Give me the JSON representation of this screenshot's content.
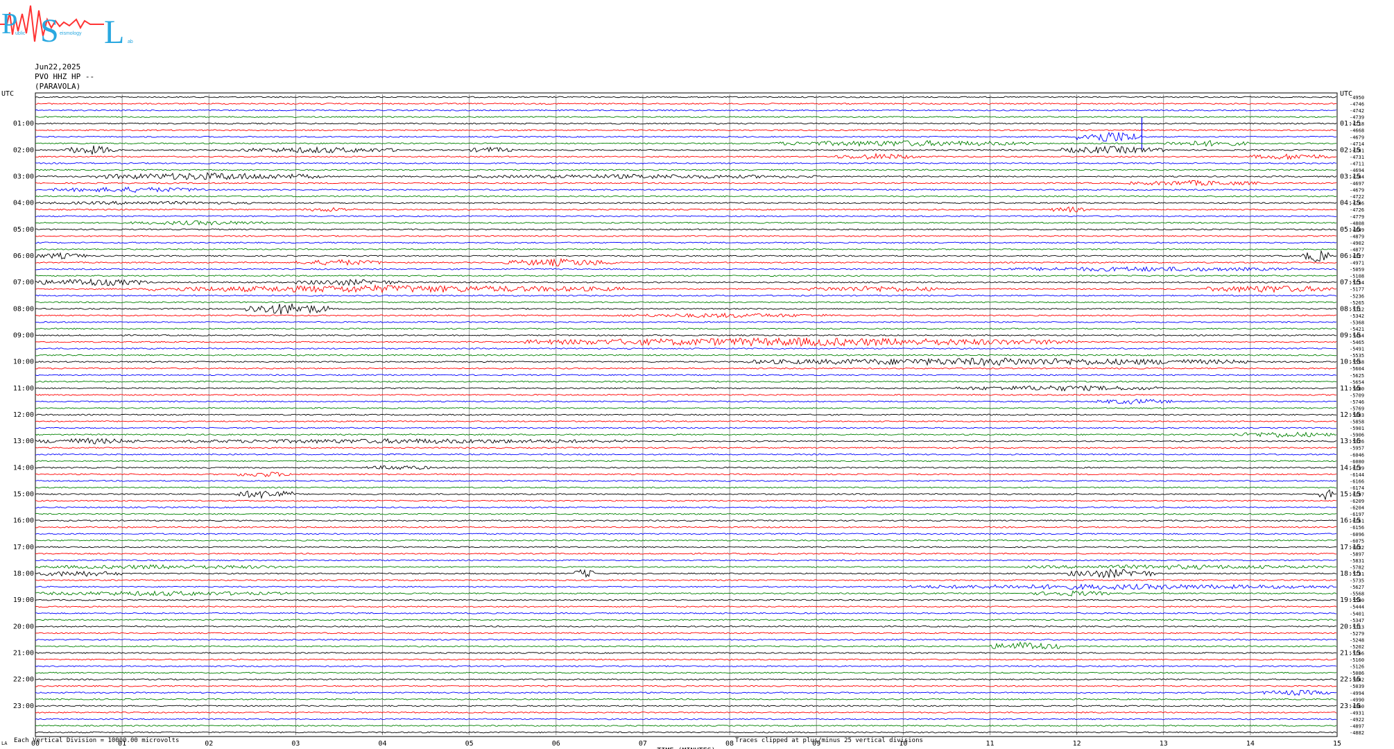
{
  "logo": {
    "big_letters": [
      "P",
      "S",
      "L"
    ],
    "small_text": [
      "ublic",
      "eismology",
      "ab"
    ],
    "colors": {
      "letters": "#29a8e0",
      "wave": "#ff3333"
    }
  },
  "header": {
    "date": "Jun22,2025",
    "station": "PVO HHZ HP --",
    "location": "(PARAVOLA)"
  },
  "axes": {
    "left_label": "UTC",
    "right_label": "UTC",
    "xlabel": "TIME (MINUTES)",
    "x_ticks": [
      "00",
      "01",
      "02",
      "03",
      "04",
      "05",
      "06",
      "07",
      "08",
      "09",
      "10",
      "11",
      "12",
      "13",
      "14",
      "15"
    ],
    "left_hours": [
      "01:00",
      "02:00",
      "03:00",
      "04:00",
      "05:00",
      "06:00",
      "07:00",
      "08:00",
      "09:00",
      "10:00",
      "11:00",
      "12:00",
      "13:00",
      "14:00",
      "15:00",
      "16:00",
      "17:00",
      "18:00",
      "19:00",
      "20:00",
      "21:00",
      "22:00",
      "23:00"
    ],
    "right_hours": [
      "01:15",
      "02:15",
      "03:15",
      "04:15",
      "05:15",
      "06:15",
      "07:15",
      "08:15",
      "09:15",
      "10:15",
      "11:15",
      "12:15",
      "13:15",
      "14:15",
      "15:15",
      "16:15",
      "17:15",
      "18:15",
      "19:15",
      "20:15",
      "21:15",
      "22:15",
      "23:15"
    ]
  },
  "footer": {
    "left_mark": "LA",
    "scale_note": "Each Vertical Division = 10000.00 microvolts",
    "clip_note": "Traces clipped at plus/minus 25 vertical divisions"
  },
  "chart_data": {
    "type": "line",
    "title": "",
    "xlabel": "TIME (MINUTES)",
    "ylabel": "UTC",
    "xlim": [
      0,
      15
    ],
    "trace_colors": [
      "#000000",
      "#ff0000",
      "#0000ff",
      "#008000"
    ],
    "trace_offsets": [
      -4950,
      -4746,
      -4742,
      -4739,
      -4718,
      -4668,
      -4679,
      -4714,
      -4741,
      -4731,
      -4711,
      -4694,
      -4744,
      -4697,
      -4679,
      -4722,
      -4746,
      -4726,
      -4779,
      -4808,
      -4849,
      -4879,
      -4902,
      -4877,
      -4927,
      -4971,
      -5059,
      -5108,
      -5154,
      -5177,
      -5236,
      -5265,
      -5312,
      -5342,
      -5368,
      -5421,
      -5454,
      -5465,
      -5491,
      -5535,
      -5558,
      -5604,
      -5625,
      -5654,
      -5680,
      -5709,
      -5746,
      -5769,
      -5803,
      -5858,
      -5901,
      -5906,
      -5926,
      -5957,
      -6046,
      -6080,
      -6139,
      -6144,
      -6166,
      -6174,
      -6197,
      -6209,
      -6204,
      -6197,
      -6161,
      -6156,
      -6096,
      -6075,
      -6032,
      -5897,
      -5831,
      -5782,
      -5731,
      -5735,
      -5627,
      -5568,
      -5540,
      -5444,
      -5401,
      -5347,
      -5313,
      -5279,
      -5248,
      -5202,
      -5166,
      -5160,
      -5126,
      -5086,
      -5042,
      -5039,
      -4994,
      -4990,
      -4960,
      -4931,
      -4922,
      -4897,
      -4882
    ],
    "events": [
      {
        "trace": 6,
        "start": 12.0,
        "end": 12.75,
        "amp": 4,
        "spike": 12.75
      },
      {
        "trace": 8,
        "start": 0.35,
        "end": 0.95,
        "amp": 3
      },
      {
        "trace": 8,
        "start": 2.3,
        "end": 4.2,
        "amp": 2
      },
      {
        "trace": 8,
        "start": 5.0,
        "end": 5.5,
        "amp": 2
      },
      {
        "trace": 8,
        "start": 11.8,
        "end": 13.0,
        "amp": 2.5
      },
      {
        "trace": 7,
        "start": 8.5,
        "end": 11.5,
        "amp": 2
      },
      {
        "trace": 7,
        "start": 13.0,
        "end": 14.0,
        "amp": 2
      },
      {
        "trace": 9,
        "start": 9.2,
        "end": 10.2,
        "amp": 2
      },
      {
        "trace": 9,
        "start": 14.0,
        "end": 14.95,
        "amp": 2
      },
      {
        "trace": 12,
        "start": 0.7,
        "end": 3.3,
        "amp": 2.5
      },
      {
        "trace": 12,
        "start": 5.0,
        "end": 9.0,
        "amp": 1.5
      },
      {
        "trace": 13,
        "start": 12.6,
        "end": 14.1,
        "amp": 1.8
      },
      {
        "trace": 14,
        "start": 0.2,
        "end": 2.0,
        "amp": 1.8
      },
      {
        "trace": 16,
        "start": 0.0,
        "end": 2.5,
        "amp": 1.2
      },
      {
        "trace": 17,
        "start": 3.1,
        "end": 3.7,
        "amp": 1.5
      },
      {
        "trace": 17,
        "start": 11.7,
        "end": 12.1,
        "amp": 2
      },
      {
        "trace": 19,
        "start": 1.1,
        "end": 2.7,
        "amp": 1.5
      },
      {
        "trace": 24,
        "start": 0.0,
        "end": 0.6,
        "amp": 2
      },
      {
        "trace": 24,
        "start": 14.6,
        "end": 14.95,
        "amp": 4
      },
      {
        "trace": 25,
        "start": 3.0,
        "end": 4.0,
        "amp": 2
      },
      {
        "trace": 25,
        "start": 5.4,
        "end": 6.7,
        "amp": 2.5
      },
      {
        "trace": 26,
        "start": 11.0,
        "end": 14.5,
        "amp": 1.6
      },
      {
        "trace": 28,
        "start": 0.0,
        "end": 1.3,
        "amp": 2.5
      },
      {
        "trace": 28,
        "start": 3.0,
        "end": 4.2,
        "amp": 2
      },
      {
        "trace": 29,
        "start": 1.3,
        "end": 6.8,
        "amp": 2.5
      },
      {
        "trace": 29,
        "start": 8.9,
        "end": 10.5,
        "amp": 2
      },
      {
        "trace": 29,
        "start": 13.5,
        "end": 14.95,
        "amp": 2.5
      },
      {
        "trace": 32,
        "start": 2.4,
        "end": 3.4,
        "amp": 4
      },
      {
        "trace": 33,
        "start": 6.7,
        "end": 9.2,
        "amp": 1.5
      },
      {
        "trace": 37,
        "start": 5.6,
        "end": 12.0,
        "amp": 2.8
      },
      {
        "trace": 40,
        "start": 8.2,
        "end": 14.0,
        "amp": 2.5
      },
      {
        "trace": 44,
        "start": 10.6,
        "end": 13.0,
        "amp": 1.8
      },
      {
        "trace": 46,
        "start": 12.2,
        "end": 13.1,
        "amp": 1.8
      },
      {
        "trace": 52,
        "start": 0.0,
        "end": 1.2,
        "amp": 2
      },
      {
        "trace": 52,
        "start": 1.6,
        "end": 7.0,
        "amp": 1.6
      },
      {
        "trace": 51,
        "start": 13.8,
        "end": 14.95,
        "amp": 2
      },
      {
        "trace": 56,
        "start": 3.8,
        "end": 4.6,
        "amp": 1.6
      },
      {
        "trace": 57,
        "start": 2.3,
        "end": 3.0,
        "amp": 1.8
      },
      {
        "trace": 60,
        "start": 2.3,
        "end": 3.0,
        "amp": 3
      },
      {
        "trace": 60,
        "start": 14.8,
        "end": 14.95,
        "amp": 4
      },
      {
        "trace": 72,
        "start": 0.0,
        "end": 1.0,
        "amp": 2
      },
      {
        "trace": 72,
        "start": 6.2,
        "end": 6.45,
        "amp": 3
      },
      {
        "trace": 72,
        "start": 11.9,
        "end": 12.9,
        "amp": 3
      },
      {
        "trace": 71,
        "start": 0.0,
        "end": 3.0,
        "amp": 1.5
      },
      {
        "trace": 71,
        "start": 11.4,
        "end": 14.95,
        "amp": 1.5
      },
      {
        "trace": 74,
        "start": 10.0,
        "end": 14.95,
        "amp": 1.8
      },
      {
        "trace": 75,
        "start": 0.0,
        "end": 2.9,
        "amp": 1.6
      },
      {
        "trace": 75,
        "start": 11.5,
        "end": 12.4,
        "amp": 1.8
      },
      {
        "trace": 83,
        "start": 11.0,
        "end": 11.8,
        "amp": 3
      },
      {
        "trace": 90,
        "start": 14.1,
        "end": 14.95,
        "amp": 1.8
      }
    ]
  }
}
